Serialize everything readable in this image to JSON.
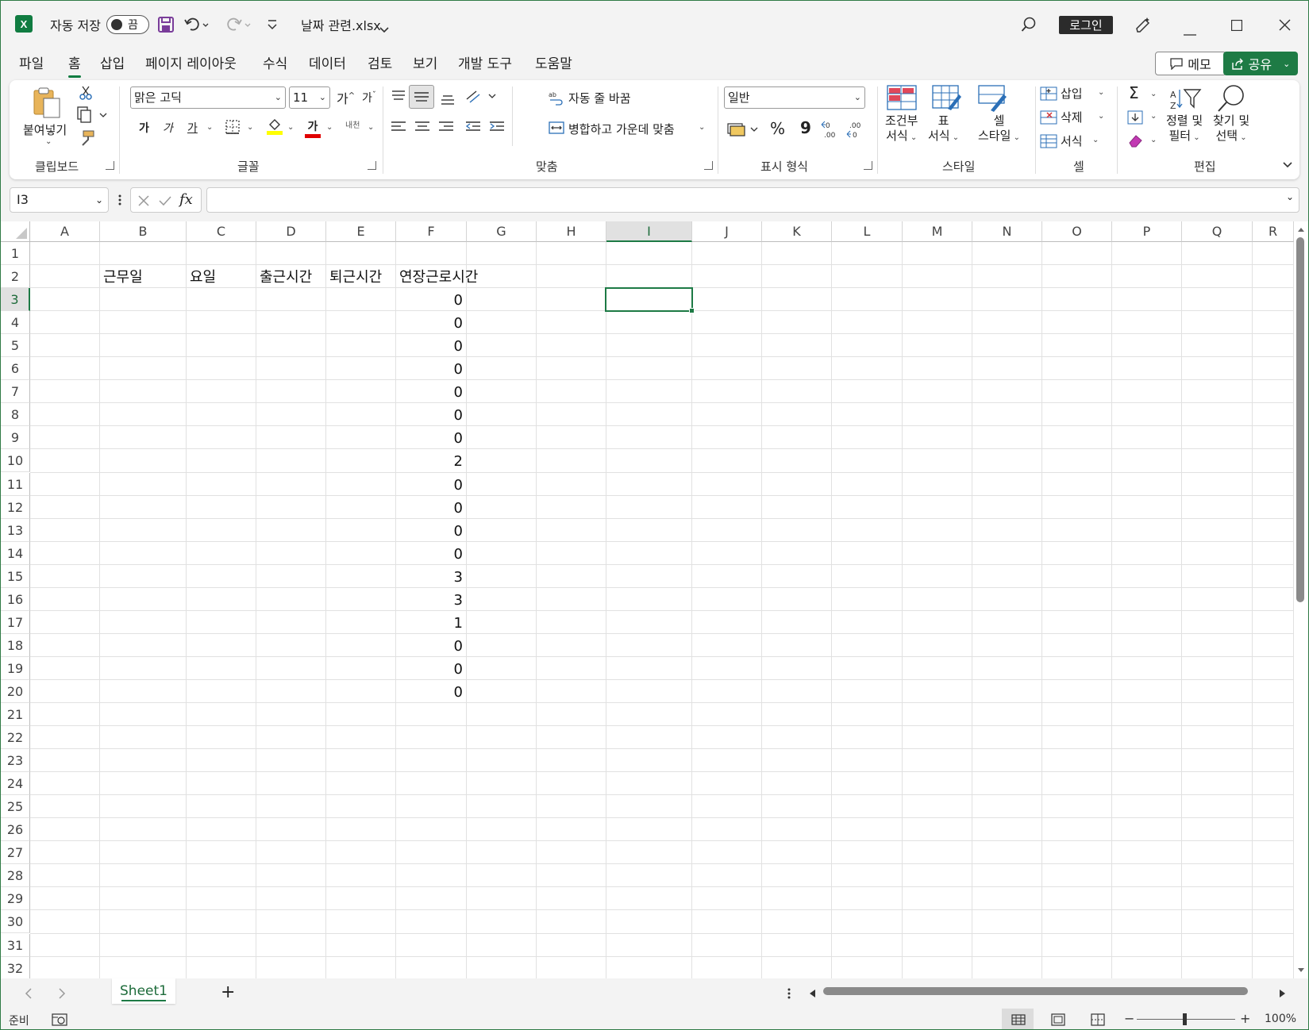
{
  "titlebar": {
    "autosave_label": "자동 저장",
    "autosave_state": "끔",
    "filename": "날짜 관련.xlsx",
    "login_label": "로그인"
  },
  "menu": {
    "tabs": [
      {
        "label": "파일"
      },
      {
        "label": "홈"
      },
      {
        "label": "삽입"
      },
      {
        "label": "페이지 레이아웃"
      },
      {
        "label": "수식"
      },
      {
        "label": "데이터"
      },
      {
        "label": "검토"
      },
      {
        "label": "보기"
      },
      {
        "label": "개발 도구"
      },
      {
        "label": "도움말"
      }
    ],
    "memo_label": "메모",
    "share_label": "공유"
  },
  "ribbon": {
    "clipboard": {
      "paste": "붙여넣기",
      "group": "클립보드"
    },
    "font": {
      "name": "맑은 고딕",
      "size": "11",
      "group": "글꼴",
      "bold": "가",
      "italic": "가",
      "underline": "가",
      "grow": "가",
      "shrink": "가",
      "color_glyph": "가",
      "phonetic": "내천"
    },
    "alignment": {
      "wrap": "자동 줄 바꿈",
      "merge": "병합하고 가운데 맞춤",
      "group": "맞춤"
    },
    "number": {
      "format": "일반",
      "group": "표시 형식",
      "percent": "%",
      "comma": "9"
    },
    "styles": {
      "conditional_1": "조건부",
      "conditional_2": "서식",
      "table_1": "표",
      "table_2": "서식",
      "cell_1": "셀",
      "cell_2": "스타일",
      "group": "스타일"
    },
    "cells": {
      "insert": "삽입",
      "delete": "삭제",
      "format": "서식",
      "group": "셀"
    },
    "editing": {
      "sort_1": "정렬 및",
      "sort_2": "필터",
      "find_1": "찾기 및",
      "find_2": "선택",
      "group": "편집",
      "sigma": "Σ"
    }
  },
  "formula_bar": {
    "name_box": "I3",
    "fx": "fx",
    "formula": ""
  },
  "grid": {
    "columns": [
      "A",
      "B",
      "C",
      "D",
      "E",
      "F",
      "G",
      "H",
      "I",
      "J",
      "K",
      "L",
      "M",
      "N",
      "O",
      "P",
      "Q",
      "R"
    ],
    "selected_column": "I",
    "selected_row": "3",
    "rows": [
      "1",
      "2",
      "3",
      "4",
      "5",
      "6",
      "7",
      "8",
      "9",
      "10",
      "11",
      "12",
      "13",
      "14",
      "15",
      "16",
      "17",
      "18",
      "19",
      "20",
      "21",
      "22",
      "23",
      "24",
      "25",
      "26",
      "27",
      "28",
      "29",
      "30",
      "31",
      "32"
    ],
    "headers": {
      "B2": "근무일",
      "C2": "요일",
      "D2": "출근시간",
      "E2": "퇴근시간",
      "F2": "연장근로시간"
    },
    "overtime_values": [
      "0",
      "0",
      "0",
      "0",
      "0",
      "0",
      "0",
      "2",
      "0",
      "0",
      "0",
      "0",
      "3",
      "3",
      "1",
      "0",
      "0",
      "0"
    ]
  },
  "sheets": {
    "tabs": [
      "Sheet1"
    ],
    "add": "+"
  },
  "status": {
    "mode": "준비",
    "zoom": "100%",
    "zoom_minus": "−",
    "zoom_plus": "+"
  },
  "colors": {
    "accent": "#107c41",
    "share": "#1e7b45",
    "selection": "#1d7a45"
  }
}
